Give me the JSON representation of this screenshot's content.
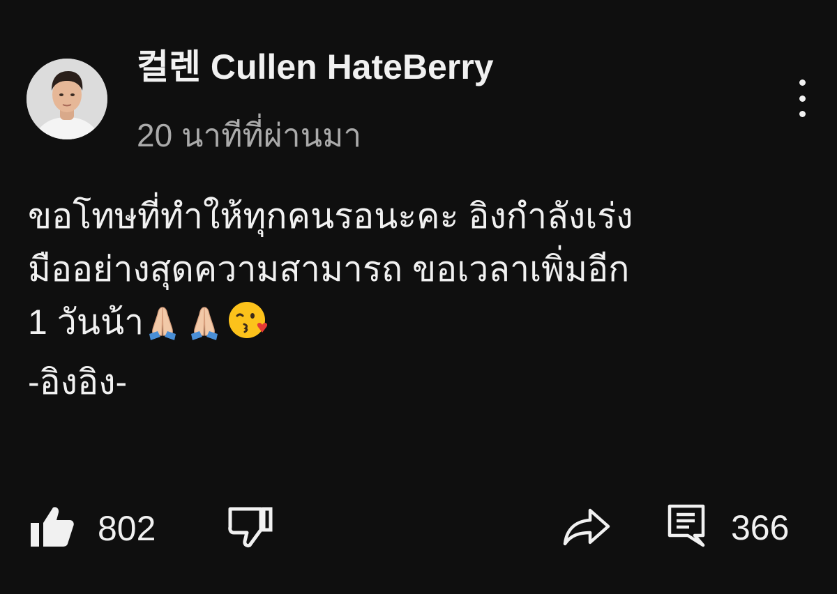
{
  "comment": {
    "author": "컬렌 Cullen HateBerry",
    "timestamp": "20 นาทีที่ผ่านมา",
    "body": {
      "line1": "ขอโทษที่ทำให้ทุกคนรอนะคะ อิงกำลังเร่ง",
      "line2": "มืออย่างสุดความสามารถ ขอเวลาเพิ่มอีก",
      "line3": "1 วันน้า",
      "signature": "-อิงอิง-"
    },
    "emojis": [
      "folded-hands-icon",
      "folded-hands-icon",
      "face-blowing-kiss-icon"
    ]
  },
  "actions": {
    "like_count": "802",
    "reply_count": "366",
    "icons": [
      "thumbs-up-icon",
      "thumbs-down-icon",
      "share-icon",
      "comment-icon",
      "more-vert-icon"
    ]
  },
  "colors": {
    "background": "#0f0f0f",
    "text": "#f1f1f1",
    "secondary_text": "#aaaaaa"
  }
}
